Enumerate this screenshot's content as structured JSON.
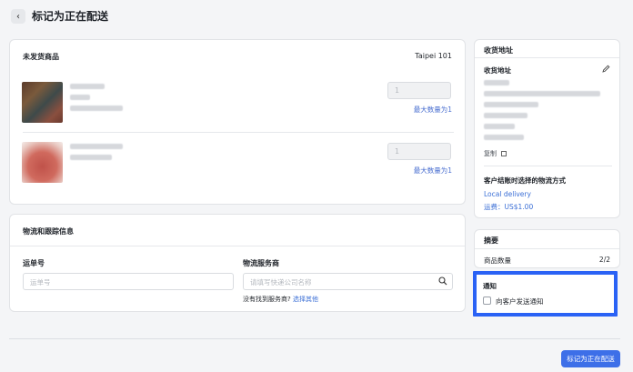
{
  "header": {
    "back_icon": "chevron-left-icon",
    "title": "标记为正在配送"
  },
  "unshipped": {
    "title": "未发货商品",
    "location": "Taipei 101",
    "items": [
      {
        "quantity": "1",
        "max_label": "最大数量为1"
      },
      {
        "quantity": "1",
        "max_label": "最大数量为1"
      }
    ]
  },
  "tracking": {
    "title": "物流和跟踪信息",
    "tracking_label": "运单号",
    "tracking_placeholder": "运单号",
    "carrier_label": "物流服务商",
    "carrier_placeholder": "请填写快递公司名称",
    "not_found_text": "没有找到服务商?",
    "select_other": "选择其他"
  },
  "address": {
    "title": "收货地址",
    "subtitle": "收货地址",
    "copy_label": "复制",
    "shipping_method_title": "客户结账时选择的物流方式",
    "shipping_method": "Local delivery",
    "shipping_fee": "运费：US$1.00"
  },
  "summary": {
    "title": "摘要",
    "item_count_label": "商品数量",
    "item_count_value": "2/2",
    "notify_title": "通知",
    "notify_label": "向客户发送通知",
    "notify_checked": false
  },
  "footer": {
    "submit_label": "标记为正在配送"
  },
  "colors": {
    "accent": "#3d6fe8",
    "highlight": "#2a62f5"
  }
}
